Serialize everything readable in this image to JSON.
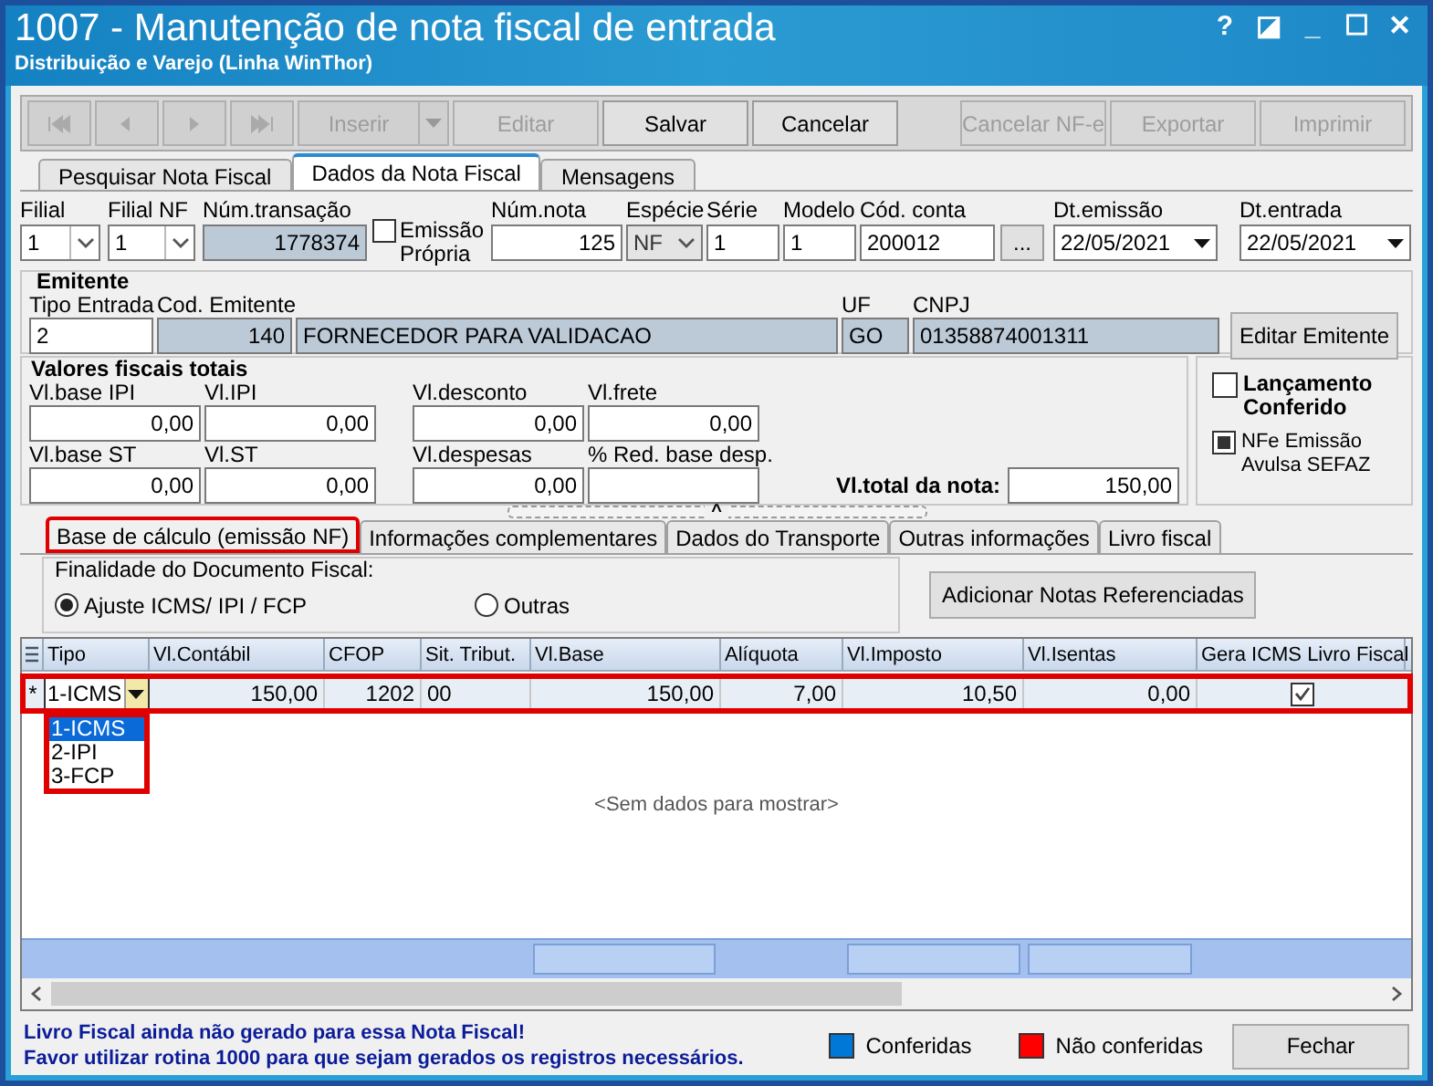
{
  "window": {
    "title": "1007 - Manutenção de nota fiscal de entrada",
    "subtitle": "Distribuição e Varejo (Linha WinThor)",
    "controls": [
      "?",
      "◪",
      "_",
      "☐",
      "✕"
    ]
  },
  "toolbar": [
    {
      "kind": "icon",
      "disabled": true
    },
    {
      "kind": "icon",
      "disabled": true
    },
    {
      "kind": "icon",
      "disabled": true
    },
    {
      "kind": "icon",
      "disabled": true
    },
    {
      "kind": "split",
      "label": "Inserir",
      "disabled": true
    },
    {
      "kind": "text",
      "label": "Editar",
      "disabled": true
    },
    {
      "kind": "text",
      "label": "Salvar",
      "disabled": false
    },
    {
      "kind": "text",
      "label": "Cancelar",
      "disabled": false
    },
    {
      "kind": "spacer"
    },
    {
      "kind": "text",
      "label": "Cancelar NF-e",
      "disabled": true
    },
    {
      "kind": "text",
      "label": "Exportar",
      "disabled": true
    },
    {
      "kind": "text",
      "label": "Imprimir",
      "disabled": true
    }
  ],
  "tabs": [
    {
      "label": "Pesquisar Nota Fiscal",
      "selected": false
    },
    {
      "label": "Dados da Nota Fiscal",
      "selected": true
    },
    {
      "label": "Mensagens",
      "selected": false
    }
  ],
  "header_fields": [
    {
      "kind": "combo",
      "label": "Filial",
      "value": "1"
    },
    {
      "kind": "combo",
      "label": "Filial NF",
      "value": "1"
    },
    {
      "kind": "readonly",
      "label": "Núm.transação",
      "value": "1778374"
    },
    {
      "kind": "checkbox",
      "label": "Emissão Própria",
      "checked": false
    },
    {
      "kind": "text",
      "label": "Núm.nota",
      "value": "125"
    },
    {
      "kind": "combo",
      "label": "Espécie",
      "value": "NF",
      "disabled": true
    },
    {
      "kind": "text",
      "label": "Série",
      "value": "1"
    },
    {
      "kind": "text",
      "label": "Modelo",
      "value": "1"
    },
    {
      "kind": "lookup",
      "label": "Cód. conta",
      "value": "200012",
      "button": "..."
    },
    {
      "kind": "date",
      "label": "Dt.emissão",
      "value": "22/05/2021"
    },
    {
      "kind": "date",
      "label": "Dt.entrada",
      "value": "22/05/2021"
    }
  ],
  "emitente": {
    "title": "Emitente",
    "fields": [
      {
        "kind": "text",
        "label": "Tipo Entrada",
        "value": "2"
      },
      {
        "kind": "readonly",
        "label": "Cod. Emitente",
        "value": "140"
      },
      {
        "kind": "readonly",
        "value": "FORNECEDOR PARA VALIDACAO"
      },
      {
        "kind": "readonly",
        "label": "UF",
        "value": "GO"
      },
      {
        "kind": "readonly",
        "label": "CNPJ",
        "value": "01358874001311"
      }
    ],
    "button": "Editar Emitente"
  },
  "valores": {
    "title": "Valores fiscais totais",
    "rows": [
      [
        {
          "label": "Vl.base IPI",
          "value": "0,00"
        },
        {
          "label": "Vl.IPI",
          "value": "0,00"
        },
        {
          "label": "Vl.desconto",
          "value": "0,00"
        },
        {
          "label": "Vl.frete",
          "value": "0,00"
        }
      ],
      [
        {
          "label": "Vl.base ST",
          "value": "0,00"
        },
        {
          "label": "Vl.ST",
          "value": "0,00"
        },
        {
          "label": "Vl.despesas",
          "value": "0,00"
        },
        {
          "label": "% Red. base desp."
        }
      ]
    ],
    "total": {
      "label": "Vl.total da nota:",
      "value": "150,00"
    }
  },
  "flags": [
    {
      "label": "Lançamento Conferido",
      "checked": false,
      "bold": true
    },
    {
      "label": "NFe Emissão Avulsa SEFAZ",
      "checked": true,
      "bold": false
    }
  ],
  "splitter": "^",
  "sub_tabs": [
    {
      "label": "Base de cálculo (emissão NF)",
      "selected": true,
      "highlighted": true
    },
    {
      "label": "Informações complementares",
      "selected": false,
      "highlighted": false
    },
    {
      "label": "Dados do Transporte",
      "selected": false,
      "highlighted": false
    },
    {
      "label": "Outras informações",
      "selected": false,
      "highlighted": false
    },
    {
      "label": "Livro fiscal",
      "selected": false,
      "highlighted": false
    }
  ],
  "finalidade": {
    "title": "Finalidade do Documento Fiscal:",
    "options": [
      {
        "label": "Ajuste ICMS/ IPI / FCP",
        "selected": true
      },
      {
        "label": "Outras",
        "selected": false
      }
    ],
    "button": "Adicionar Notas Referenciadas"
  },
  "table": {
    "columns": [
      "Tipo",
      "Vl.Contábil",
      "CFOP",
      "Sit. Tribut.",
      "Vl.Base",
      "Alíquota",
      "Vl.Imposto",
      "Vl.Isentas",
      "Gera ICMS Livro Fiscal"
    ],
    "rows": [
      {
        "indicator": "*",
        "highlighted": true,
        "cells": [
          "1-ICMS",
          "150,00",
          "1202",
          "00",
          "150,00",
          "7,00",
          "10,50",
          "0,00"
        ],
        "gera_icms": true
      }
    ],
    "dropdown": {
      "highlighted": true,
      "options": [
        {
          "label": "1-ICMS",
          "selected": true
        },
        {
          "label": "2-IPI",
          "selected": false
        },
        {
          "label": "3-FCP",
          "selected": false
        }
      ]
    },
    "empty_text": "<Sem dados para mostrar>"
  },
  "status": {
    "messages": [
      "Livro Fiscal ainda não gerado para essa Nota Fiscal!",
      "Favor utilizar rotina 1000 para que sejam gerados os registros necessários."
    ],
    "legend": [
      {
        "label": "Conferidas",
        "color": "#0078d7"
      },
      {
        "label": "Não conferidas",
        "color": "#ff0000"
      }
    ],
    "button": "Fechar"
  }
}
